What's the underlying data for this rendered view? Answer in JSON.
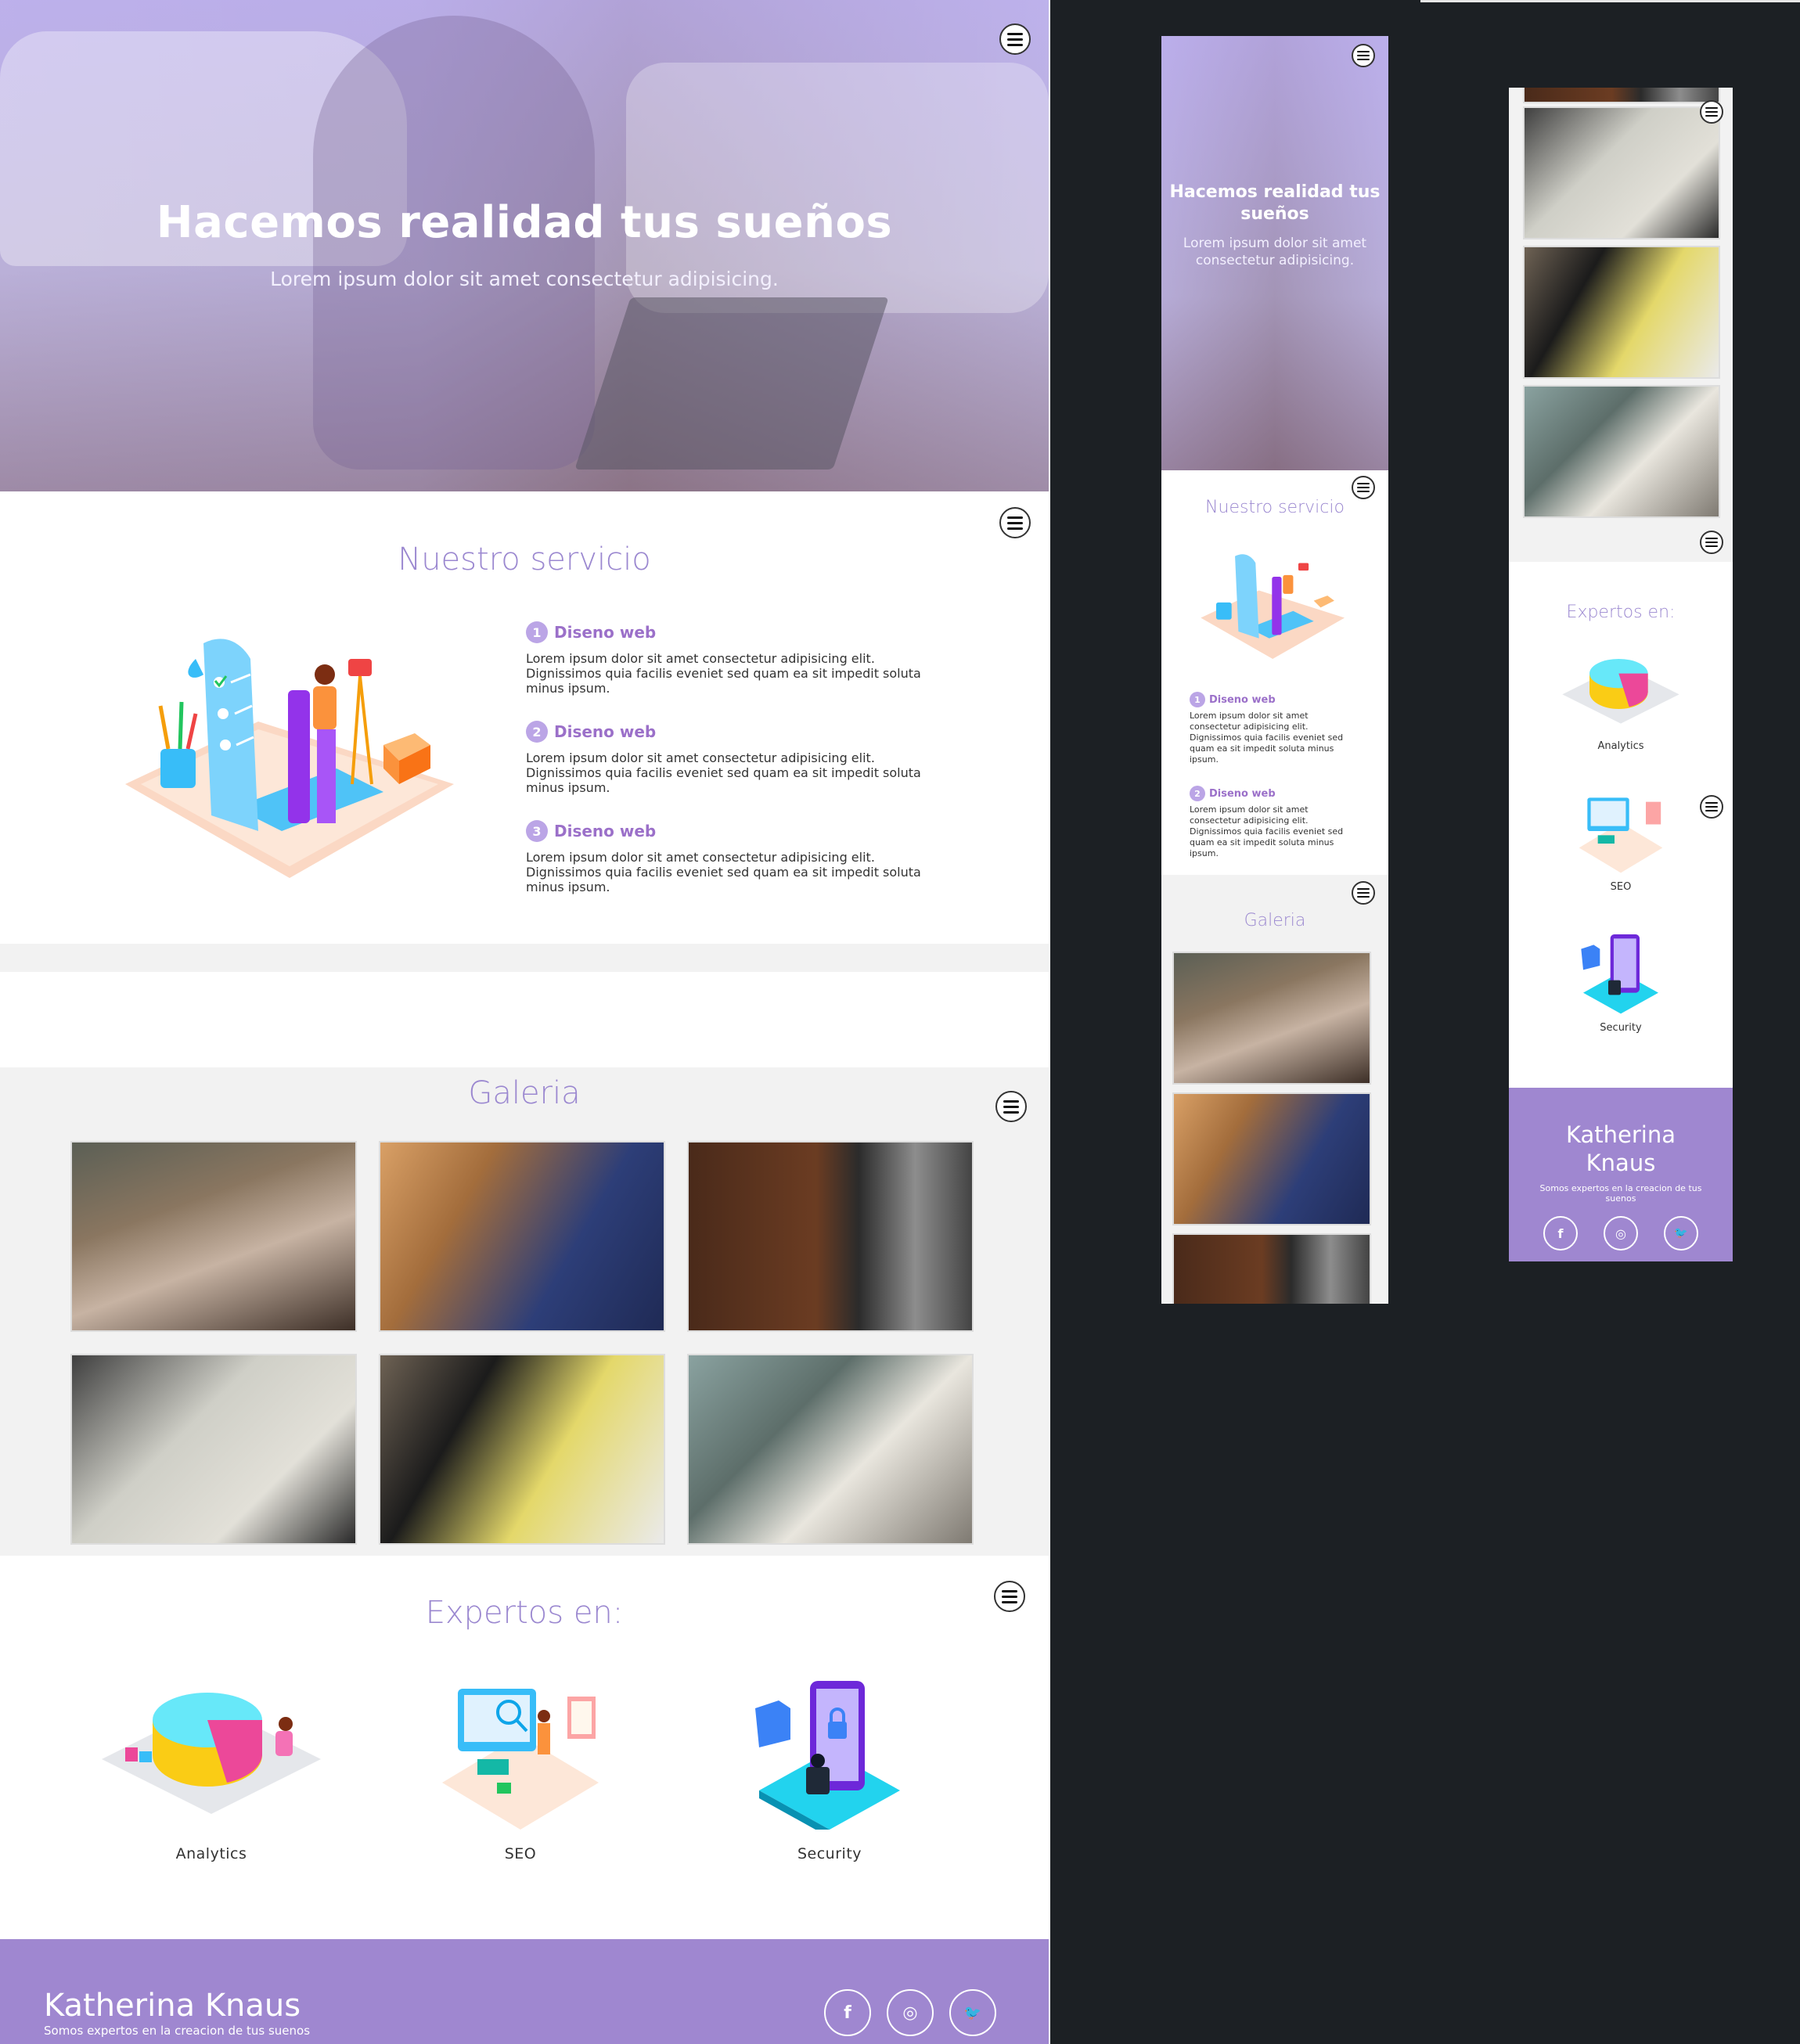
{
  "hero": {
    "title": "Hacemos realidad tus sueños",
    "subtitle": "Lorem ipsum dolor sit amet consectetur adipisicing."
  },
  "services": {
    "title": "Nuestro servicio",
    "items": [
      {
        "num": "1",
        "title": "Diseno web",
        "text": "Lorem ipsum dolor sit amet consectetur adipisicing elit. Dignissimos quia facilis eveniet sed quam ea sit impedit soluta minus ipsum."
      },
      {
        "num": "2",
        "title": "Diseno web",
        "text": "Lorem ipsum dolor sit amet consectetur adipisicing elit. Dignissimos quia facilis eveniet sed quam ea sit impedit soluta minus ipsum."
      },
      {
        "num": "3",
        "title": "Diseno web",
        "text": "Lorem ipsum dolor sit amet consectetur adipisicing elit. Dignissimos quia facilis eveniet sed quam ea sit impedit soluta minus ipsum."
      }
    ]
  },
  "gallery": {
    "title": "Galeria"
  },
  "experts": {
    "title": "Expertos en:",
    "items": [
      {
        "label": "Analytics",
        "icon": "analytics-illustration"
      },
      {
        "label": "SEO",
        "icon": "seo-illustration"
      },
      {
        "label": "Security",
        "icon": "security-illustration"
      }
    ]
  },
  "footer": {
    "brand": "Katherina Knaus",
    "brand_line1": "Katherina",
    "brand_line2": "Knaus",
    "tagline": "Somos expertos en la creacion de tus suenos",
    "social": [
      {
        "icon": "facebook-icon",
        "glyph": "f"
      },
      {
        "icon": "instagram-icon",
        "glyph": "◎"
      },
      {
        "icon": "twitter-icon",
        "glyph": "🐦"
      }
    ]
  },
  "colors": {
    "accent": "#9b88d0",
    "footer_bg": "#9f87d0",
    "section_gray": "#f2f2f2",
    "canvas_bg": "#1c2024"
  }
}
